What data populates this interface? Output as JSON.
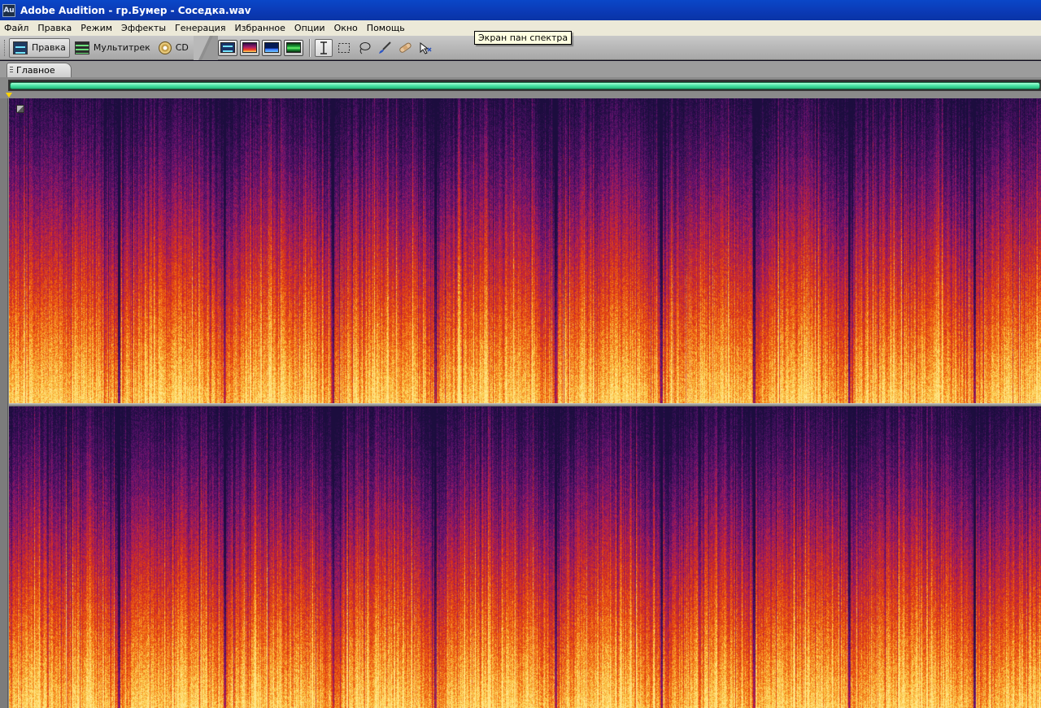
{
  "window": {
    "app_icon_label": "Au",
    "title": "Adobe Audition - гр.Бумер - Соседка.wav"
  },
  "menu": {
    "items": [
      "Файл",
      "Правка",
      "Режим",
      "Эффекты",
      "Генерация",
      "Избранное",
      "Опции",
      "Окно",
      "Помощь"
    ]
  },
  "toolbar": {
    "workspace_edit": "Правка",
    "workspace_multitrack": "Мультитрек",
    "workspace_cd": "CD"
  },
  "tooltip": {
    "text": "Экран пан спектра"
  },
  "tabs": {
    "main": "Главное"
  },
  "spectrogram": {
    "channels": 2,
    "palette": [
      "#1c0d3e",
      "#3a0f58",
      "#6a1370",
      "#a81b58",
      "#d83118",
      "#f26a10",
      "#fbc544",
      "#ffe78a"
    ]
  }
}
